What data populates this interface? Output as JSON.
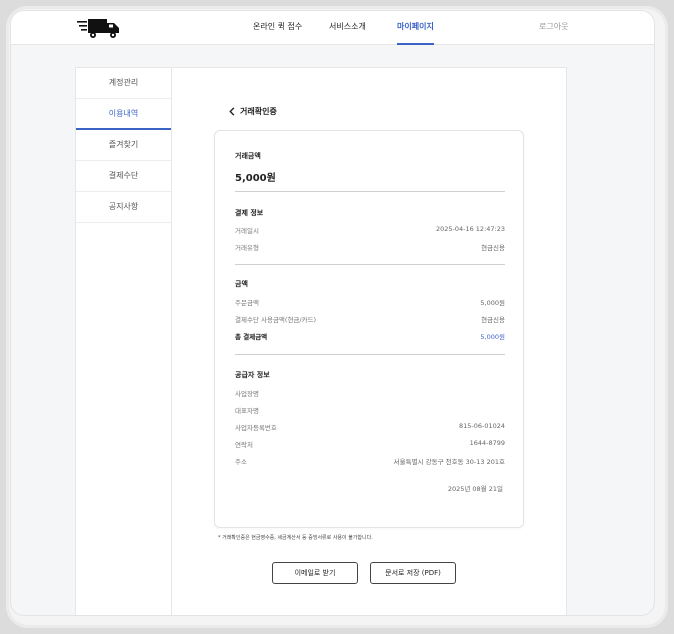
{
  "header": {
    "nav": [
      {
        "label": "온라인 퀵 접수"
      },
      {
        "label": "서비스소개"
      },
      {
        "label": "마이페이지"
      }
    ],
    "logout_label": "로그아웃",
    "accent_color": "#3b63c6"
  },
  "sidebar": {
    "items": [
      {
        "label": "계정관리"
      },
      {
        "label": "이용내역"
      },
      {
        "label": "즐겨찾기"
      },
      {
        "label": "결제수단"
      },
      {
        "label": "공지사항"
      }
    ]
  },
  "main": {
    "back_label": "거래확인증",
    "card": {
      "amount_section": {
        "title": "거래금액",
        "amount": "5,000원"
      },
      "payment_info": {
        "title": "결제 정보",
        "rows": [
          {
            "k": "거래일시",
            "v": "2025-04-16 12:47:23"
          },
          {
            "k": "거래유형",
            "v": "현금신용"
          }
        ]
      },
      "price": {
        "title": "금액",
        "rows": [
          {
            "k": "주문금액",
            "v": "5,000원"
          },
          {
            "k": "결제수단 사용금액(현금/카드)",
            "v": "현금신용"
          }
        ],
        "total": {
          "k": "총 결제금액",
          "v": "5,000원"
        }
      },
      "supplier": {
        "title": "공급자 정보",
        "rows": [
          {
            "k": "사업장명",
            "v": ""
          },
          {
            "k": "대표자명",
            "v": ""
          },
          {
            "k": "사업자등록번호",
            "v": "815-06-01024"
          },
          {
            "k": "연락처",
            "v": "1644-8799"
          },
          {
            "k": "주소",
            "v": "서울특별시 강동구 천호동 30-13 201호"
          }
        ]
      },
      "issue_date": "2025년 08월 21일"
    },
    "footnote": "* 거래확인증은 현금영수증, 세금계산서 등 증빙서류로 사용이 불가합니다.",
    "buttons": {
      "email": "이메일로 받기",
      "pdf": "문서로 저장 (PDF)"
    }
  }
}
